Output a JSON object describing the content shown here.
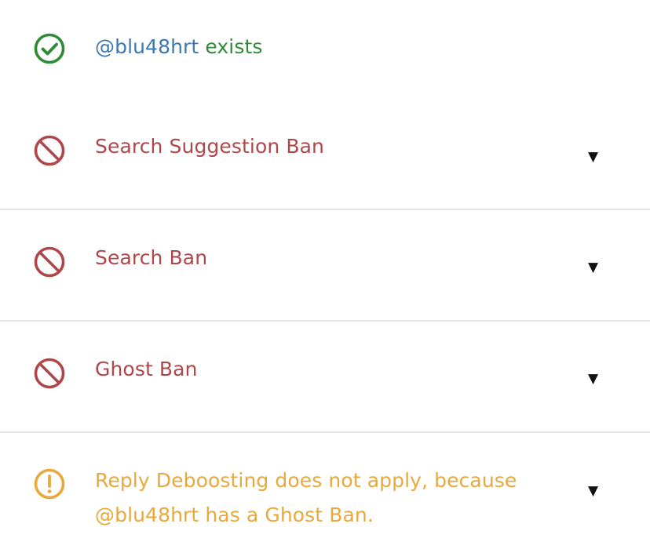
{
  "exists": {
    "handle": "@blu48hrt",
    "status_word": "exists",
    "icon": "check-circle-icon",
    "color": "#2e8b35"
  },
  "checks": [
    {
      "label": "Search Suggestion Ban",
      "icon": "ban-icon",
      "color": "#b0464a",
      "expand": "▼"
    },
    {
      "label": "Search Ban",
      "icon": "ban-icon",
      "color": "#b0464a",
      "expand": "▼"
    },
    {
      "label": "Ghost Ban",
      "icon": "ban-icon",
      "color": "#b0464a",
      "expand": "▼"
    }
  ],
  "reply_deboosting": {
    "line1": "Reply Deboosting does not apply, because",
    "line2": "@blu48hrt has a Ghost Ban.",
    "icon": "warning-circle-icon",
    "color": "#e9a83c",
    "expand": "▼"
  }
}
